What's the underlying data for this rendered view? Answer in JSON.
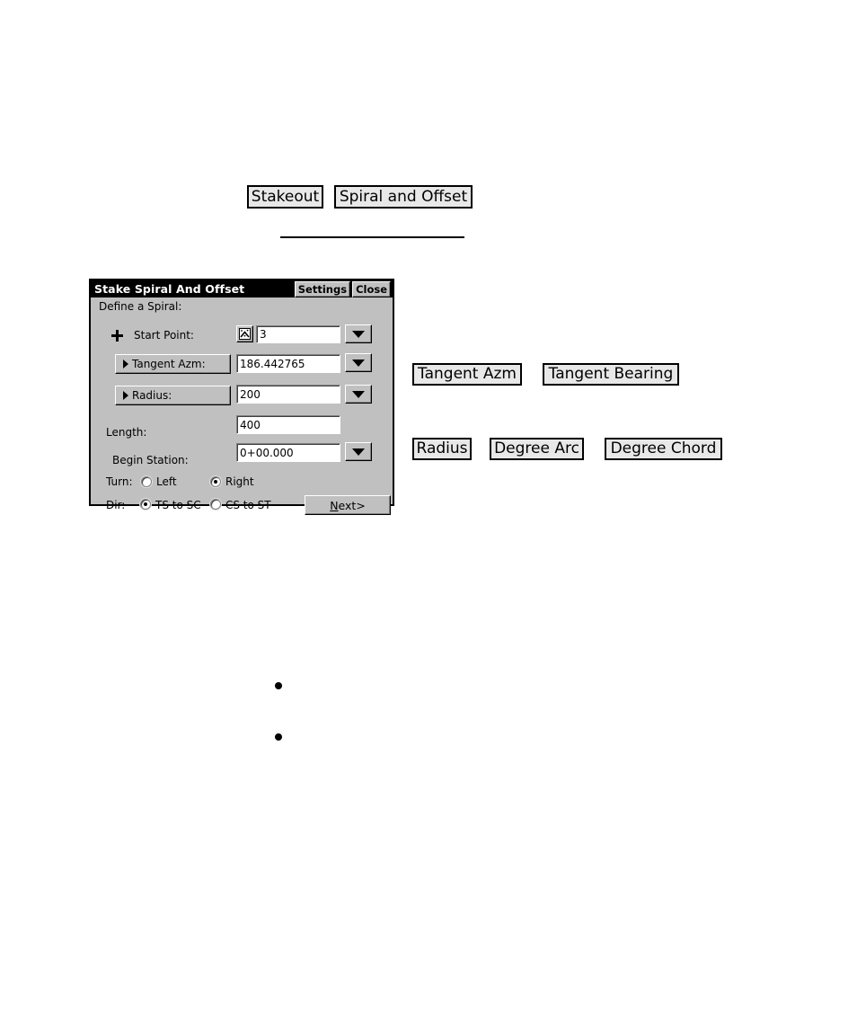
{
  "doc": {
    "caption_buttons": [
      {
        "id": "stakeout",
        "label": "Stakeout"
      },
      {
        "id": "spiral-and-offset",
        "label": "Spiral and Offset"
      },
      {
        "id": "tangent-azm",
        "label": "Tangent Azm"
      },
      {
        "id": "tangent-bearing",
        "label": "Tangent Bearing"
      },
      {
        "id": "radius",
        "label": "Radius"
      },
      {
        "id": "degree-arc",
        "label": "Degree Arc"
      },
      {
        "id": "degree-chord",
        "label": "Degree Chord"
      }
    ],
    "bullets": [
      "",
      ""
    ]
  },
  "dialog": {
    "title": "Stake Spiral And Offset",
    "titlebar_buttons": [
      {
        "id": "settings",
        "label": "Settings"
      },
      {
        "id": "close",
        "label": "Close"
      }
    ],
    "group_label": "Define a Spiral:",
    "fields": {
      "start_point": {
        "label": "Start Point:",
        "value": "3",
        "icon": "point-pick-icon",
        "marker_icon": "crosshair-icon",
        "has_dropdown": true
      },
      "tangent_azm": {
        "label": "Tangent Azm:",
        "value": "186.442765",
        "is_button": true,
        "has_dropdown": true
      },
      "radius": {
        "label": "Radius:",
        "value": "200",
        "is_button": true,
        "has_dropdown": true
      },
      "length": {
        "label": "Length:",
        "value": "400",
        "has_dropdown": false
      },
      "begin_station": {
        "label": "Begin Station:",
        "value": "0+00.000",
        "has_dropdown": true
      }
    },
    "turn": {
      "label": "Turn:",
      "options": [
        {
          "id": "left",
          "label": "Left",
          "selected": false
        },
        {
          "id": "right",
          "label": "Right",
          "selected": true
        }
      ]
    },
    "dir": {
      "label": "Dir:",
      "options": [
        {
          "id": "ts-to-sc",
          "label": "TS to SC",
          "selected": true
        },
        {
          "id": "cs-to-st",
          "label": "CS to ST",
          "selected": false
        }
      ]
    },
    "next_button": {
      "prefix": "N",
      "suffix": "ext>"
    },
    "colors": {
      "face": "#c0c0c0",
      "titlebar": "#000000",
      "field": "#ffffff"
    }
  }
}
